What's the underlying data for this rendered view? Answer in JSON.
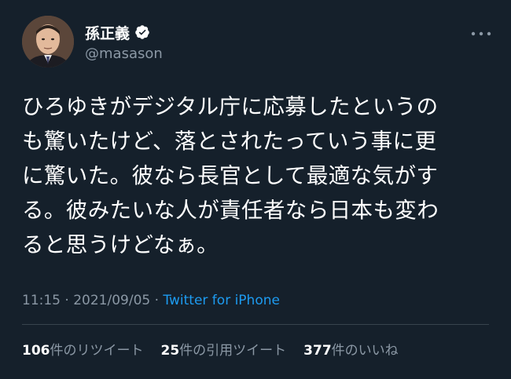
{
  "user": {
    "display_name": "孫正義",
    "handle": "@masason",
    "verified_icon": "verified-badge-icon",
    "avatar_icon": "profile-photo"
  },
  "menu": {
    "more_icon": "more-horizontal-icon"
  },
  "tweet": {
    "lines": [
      "ひろゆきがデジタル庁に応募したというの",
      "も驚いたけど、落とされたっていう事に更",
      "に驚いた。彼なら長官として最適な気がす",
      "る。彼みたいな人が責任者なら日本も変わ",
      "ると思うけどなぁ。"
    ]
  },
  "meta": {
    "time": "11:15",
    "separator": " · ",
    "date": "2021/09/05",
    "separator2": " · ",
    "source": "Twitter for iPhone"
  },
  "stats": {
    "retweets_count": "106",
    "retweets_label": "件のリツイート",
    "quotes_count": "25",
    "quotes_label": "件の引用ツイート",
    "likes_count": "377",
    "likes_label": "件のいいね"
  },
  "colors": {
    "background": "#15202b",
    "text": "#ffffff",
    "secondary": "#8b98a5",
    "link": "#1d9bf0",
    "divider": "#38444d"
  }
}
